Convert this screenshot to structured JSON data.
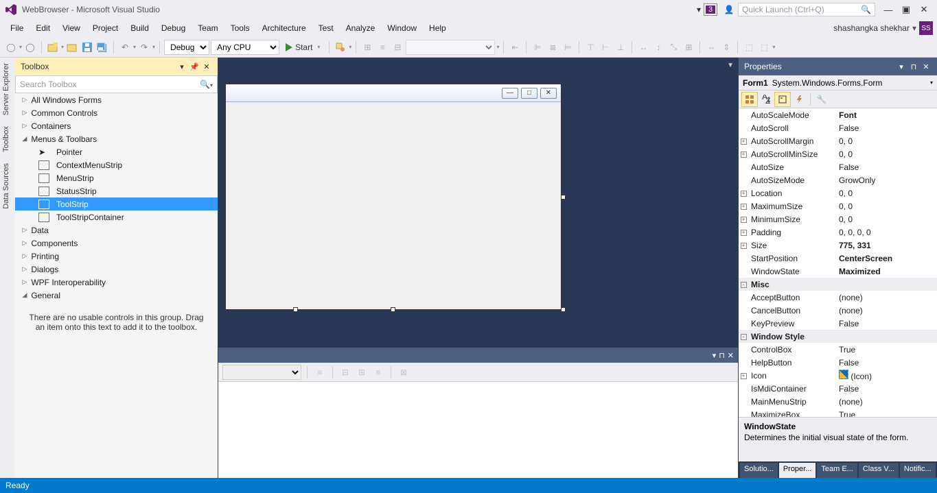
{
  "title": "WebBrowser - Microsoft Visual Studio",
  "notif_count": "3",
  "quick_launch": {
    "placeholder": "Quick Launch (Ctrl+Q)"
  },
  "user": {
    "name": "shashangka shekhar",
    "initials": "SS"
  },
  "menu": [
    "File",
    "Edit",
    "View",
    "Project",
    "Build",
    "Debug",
    "Team",
    "Tools",
    "Architecture",
    "Test",
    "Analyze",
    "Window",
    "Help"
  ],
  "config": "Debug",
  "platform": "Any CPU",
  "start_label": "Start",
  "leftrail": [
    "Server Explorer",
    "Toolbox",
    "Data Sources"
  ],
  "toolbox": {
    "title": "Toolbox",
    "search_placeholder": "Search Toolbox",
    "groups_top": [
      "All Windows Forms",
      "Common Controls",
      "Containers"
    ],
    "menus_label": "Menus & Toolbars",
    "menus_items": [
      "Pointer",
      "ContextMenuStrip",
      "MenuStrip",
      "StatusStrip",
      "ToolStrip",
      "ToolStripContainer"
    ],
    "selected": "ToolStrip",
    "groups_bottom": [
      "Data",
      "Components",
      "Printing",
      "Dialogs",
      "WPF Interoperability"
    ],
    "general": "General",
    "empty_msg": "There are no usable controls in this group. Drag an item onto this text to add it to the toolbox."
  },
  "properties": {
    "title": "Properties",
    "object_name": "Form1",
    "object_type": "System.Windows.Forms.Form",
    "rows": [
      {
        "exp": "",
        "k": "AutoScaleMode",
        "v": "Font",
        "bold": true
      },
      {
        "exp": "",
        "k": "AutoScroll",
        "v": "False"
      },
      {
        "exp": "+",
        "k": "AutoScrollMargin",
        "v": "0, 0"
      },
      {
        "exp": "+",
        "k": "AutoScrollMinSize",
        "v": "0, 0"
      },
      {
        "exp": "",
        "k": "AutoSize",
        "v": "False"
      },
      {
        "exp": "",
        "k": "AutoSizeMode",
        "v": "GrowOnly"
      },
      {
        "exp": "+",
        "k": "Location",
        "v": "0, 0"
      },
      {
        "exp": "+",
        "k": "MaximumSize",
        "v": "0, 0"
      },
      {
        "exp": "+",
        "k": "MinimumSize",
        "v": "0, 0"
      },
      {
        "exp": "+",
        "k": "Padding",
        "v": "0, 0, 0, 0"
      },
      {
        "exp": "+",
        "k": "Size",
        "v": "775, 331",
        "bold": true
      },
      {
        "exp": "",
        "k": "StartPosition",
        "v": "CenterScreen",
        "bold": true
      },
      {
        "exp": "",
        "k": "WindowState",
        "v": "Maximized",
        "bold": true
      },
      {
        "exp": "-",
        "k": "Misc",
        "v": "",
        "cat": true
      },
      {
        "exp": "",
        "k": "AcceptButton",
        "v": "(none)"
      },
      {
        "exp": "",
        "k": "CancelButton",
        "v": "(none)"
      },
      {
        "exp": "",
        "k": "KeyPreview",
        "v": "False"
      },
      {
        "exp": "-",
        "k": "Window Style",
        "v": "",
        "cat": true
      },
      {
        "exp": "",
        "k": "ControlBox",
        "v": "True"
      },
      {
        "exp": "",
        "k": "HelpButton",
        "v": "False"
      },
      {
        "exp": "+",
        "k": "Icon",
        "v": "(Icon)",
        "icon": true
      },
      {
        "exp": "",
        "k": "IsMdiContainer",
        "v": "False"
      },
      {
        "exp": "",
        "k": "MainMenuStrip",
        "v": "(none)"
      },
      {
        "exp": "",
        "k": "MaximizeBox",
        "v": "True"
      }
    ],
    "desc_title": "WindowState",
    "desc_text": "Determines the initial visual state of the form.",
    "tabs": [
      "Solutio...",
      "Proper...",
      "Team E...",
      "Class V...",
      "Notific..."
    ],
    "active_tab": 1
  },
  "status": "Ready"
}
